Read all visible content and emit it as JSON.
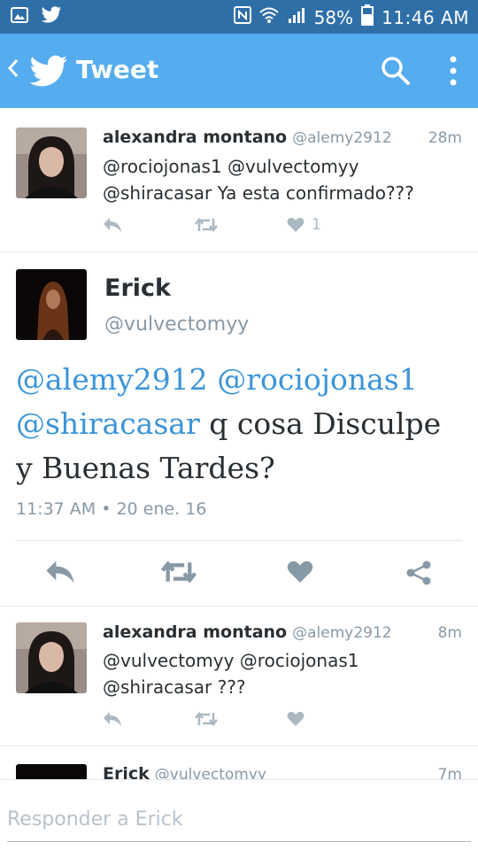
{
  "status_bar": {
    "battery_percent": "58%",
    "time": "11:46 AM"
  },
  "app_bar": {
    "title": "Tweet"
  },
  "reply_above": {
    "name": "alexandra montano",
    "handle": "@alemy2912",
    "time": "28m",
    "text_line1": "@rociojonas1 @vulvectomyy",
    "text_line2": "@shiracasar Ya esta confirmado???",
    "like_count": "1"
  },
  "main_tweet": {
    "name": "Erick",
    "handle": "@vulvectomyy",
    "mention1": "@alemy2912",
    "mention2": "@rociojonas1",
    "mention3": "@shiracasar",
    "text_rest1": " q cosa Disculpe",
    "text_rest2": "y Buenas Tardes?",
    "timestamp": "11:37 AM • 20 ene. 16"
  },
  "reply_below": {
    "name": "alexandra montano",
    "handle": "@alemy2912",
    "time": "8m",
    "text_line1": "@vulvectomyy @rociojonas1",
    "text_line2": "@shiracasar ???"
  },
  "reply_partial": {
    "name": "Erick",
    "handle": "@vulvectomyy",
    "time": "7m"
  },
  "composer": {
    "placeholder": "Responder a Erick"
  },
  "colors": {
    "status_bar": "#2f6fa8",
    "app_bar": "#55acee",
    "mention": "#3b94d9",
    "muted": "#8899a6",
    "icon": "#8899a6"
  }
}
